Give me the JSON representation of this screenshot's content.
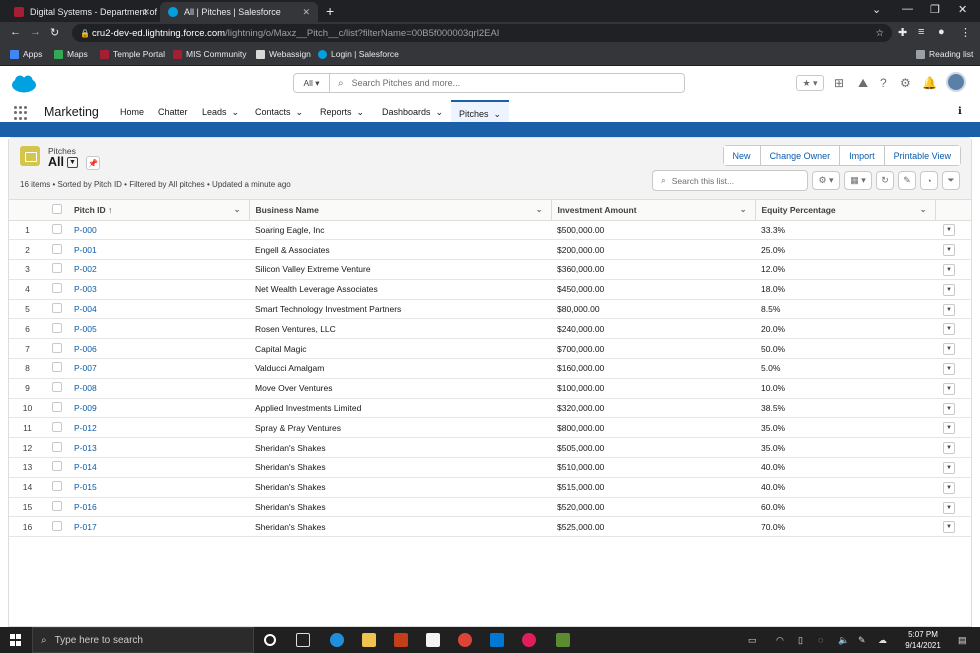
{
  "browser": {
    "tabs": [
      {
        "title": "Digital Systems - Department of",
        "active": false
      },
      {
        "title": "All | Pitches | Salesforce",
        "active": true
      }
    ],
    "url_host": "cru2-dev-ed.lightning.force.com",
    "url_path": "/lightning/o/Maxz__Pitch__c/list?filterName=00B5f000003qrl2EAI",
    "bookmarks": [
      "Apps",
      "Maps",
      "Temple Portal",
      "MIS Community",
      "Webassign",
      "Login | Salesforce"
    ],
    "reading_list": "Reading list"
  },
  "sf": {
    "search_scope": "All",
    "search_placeholder": "Search Pitches and more...",
    "app_name": "Marketing",
    "nav": [
      "Home",
      "Chatter",
      "Leads",
      "Contacts",
      "Reports",
      "Dashboards",
      "Pitches"
    ],
    "active_nav": "Pitches"
  },
  "listview": {
    "object_label": "Pitches",
    "view_name": "All",
    "meta": "16 items • Sorted by Pitch ID • Filtered by All pitches • Updated a minute ago",
    "actions": [
      "New",
      "Change Owner",
      "Import",
      "Printable View"
    ],
    "search_placeholder": "Search this list...",
    "columns": [
      "Pitch ID",
      "Business Name",
      "Investment Amount",
      "Equity Percentage"
    ],
    "sort_indicator": "↑",
    "rows": [
      [
        "1",
        "P-000",
        "Soaring Eagle, Inc",
        "$500,000.00",
        "33.3%"
      ],
      [
        "2",
        "P-001",
        "Engell & Associates",
        "$200,000.00",
        "25.0%"
      ],
      [
        "3",
        "P-002",
        "Silicon Valley Extreme Venture",
        "$360,000.00",
        "12.0%"
      ],
      [
        "4",
        "P-003",
        "Net Wealth Leverage Associates",
        "$450,000.00",
        "18.0%"
      ],
      [
        "5",
        "P-004",
        "Smart Technology Investment Partners",
        "$80,000.00",
        "8.5%"
      ],
      [
        "6",
        "P-005",
        "Rosen Ventures, LLC",
        "$240,000.00",
        "20.0%"
      ],
      [
        "7",
        "P-006",
        "Capital Magic",
        "$700,000.00",
        "50.0%"
      ],
      [
        "8",
        "P-007",
        "Valducci Amalgam",
        "$160,000.00",
        "5.0%"
      ],
      [
        "9",
        "P-008",
        "Move Over Ventures",
        "$100,000.00",
        "10.0%"
      ],
      [
        "10",
        "P-009",
        "Applied Investments Limited",
        "$320,000.00",
        "38.5%"
      ],
      [
        "11",
        "P-012",
        "Spray & Pray Ventures",
        "$800,000.00",
        "35.0%"
      ],
      [
        "12",
        "P-013",
        "Sheridan's Shakes",
        "$505,000.00",
        "35.0%"
      ],
      [
        "13",
        "P-014",
        "Sheridan's Shakes",
        "$510,000.00",
        "40.0%"
      ],
      [
        "14",
        "P-015",
        "Sheridan's Shakes",
        "$515,000.00",
        "40.0%"
      ],
      [
        "15",
        "P-016",
        "Sheridan's Shakes",
        "$520,000.00",
        "60.0%"
      ],
      [
        "16",
        "P-017",
        "Sheridan's Shakes",
        "$525,000.00",
        "70.0%"
      ]
    ]
  },
  "taskbar": {
    "search_placeholder": "Type here to search",
    "time": "5:07 PM",
    "date": "9/14/2021"
  },
  "colors": {
    "salesforce_blue": "#1b5fa8",
    "link_blue": "#0b5cab",
    "object_icon": "#d4c54d"
  }
}
